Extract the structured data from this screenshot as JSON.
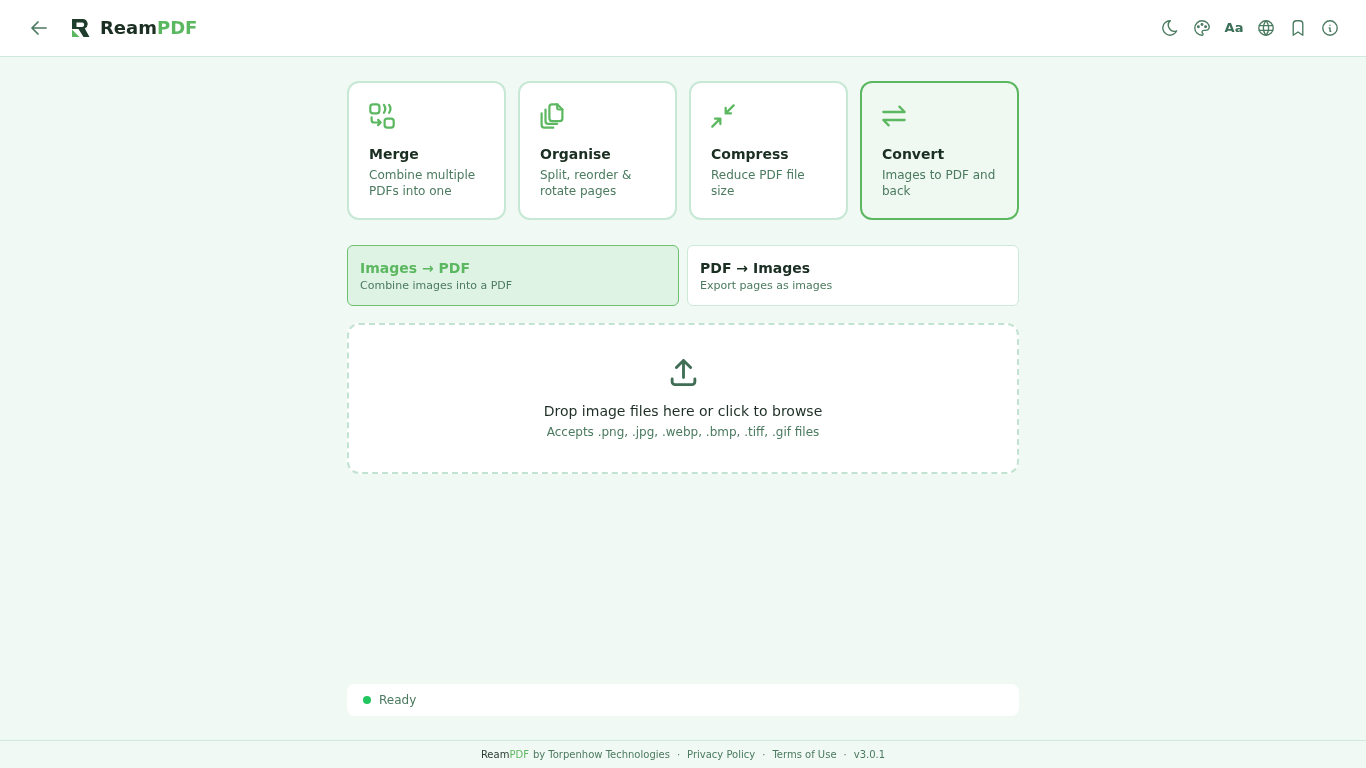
{
  "header": {
    "brand": {
      "name": "Ream",
      "accent": "PDF"
    },
    "font_button": "Aa"
  },
  "tools": [
    {
      "title": "Merge",
      "description": "Combine multiple PDFs into one",
      "selected": false
    },
    {
      "title": "Organise",
      "description": "Split, reorder & rotate pages",
      "selected": false
    },
    {
      "title": "Compress",
      "description": "Reduce PDF file size",
      "selected": false
    },
    {
      "title": "Convert",
      "description": "Images to PDF and back",
      "selected": true
    }
  ],
  "modes": [
    {
      "title": "Images → PDF",
      "description": "Combine images into a PDF",
      "selected": true
    },
    {
      "title": "PDF → Images",
      "description": "Export pages as images",
      "selected": false
    }
  ],
  "dropzone": {
    "title": "Drop image files here or click to browse",
    "hint": "Accepts .png, .jpg, .webp, .bmp, .tiff, .gif files"
  },
  "status_bar": {
    "text": "Ready"
  },
  "footer": {
    "credit": {
      "name": "Ream",
      "accent": "PDF",
      "text": "by Torpenhow Technologies"
    },
    "items": [
      {
        "separator": "·",
        "text": "Privacy Policy"
      },
      {
        "separator": "·",
        "text": "Terms of Use"
      },
      {
        "separator": "·",
        "text": "v3.0.1"
      }
    ]
  }
}
